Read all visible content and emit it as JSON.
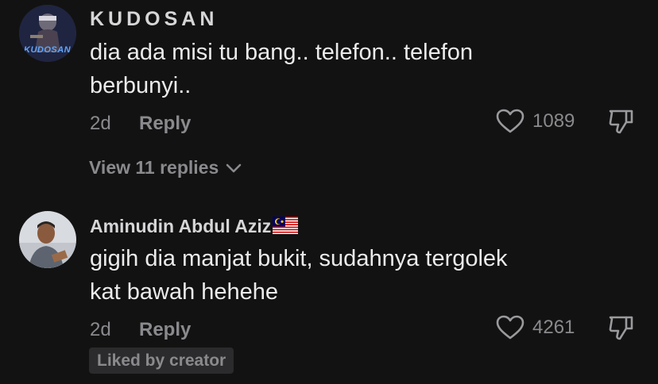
{
  "comments": [
    {
      "username": "KUDOSAN",
      "avatar_text": "KUDOSAN",
      "text_lines": [
        "dia ada misi tu bang.. telefon.. telefon",
        "berbunyi.."
      ],
      "time": "2d",
      "reply_label": "Reply",
      "likes": "1089",
      "view_replies": "View 11 replies"
    },
    {
      "username": "Aminudin Abdul Aziz",
      "flag": "malaysia-flag-icon",
      "text_lines": [
        "gigih dia manjat bukit, sudahnya tergolek",
        "kat bawah hehehe"
      ],
      "time": "2d",
      "reply_label": "Reply",
      "likes": "4261",
      "badge": "Liked by creator"
    }
  ],
  "colors": {
    "background": "#121212",
    "text": "#ebebec",
    "muted": "#8a8a8e",
    "badge_bg": "#2b2b2d"
  }
}
